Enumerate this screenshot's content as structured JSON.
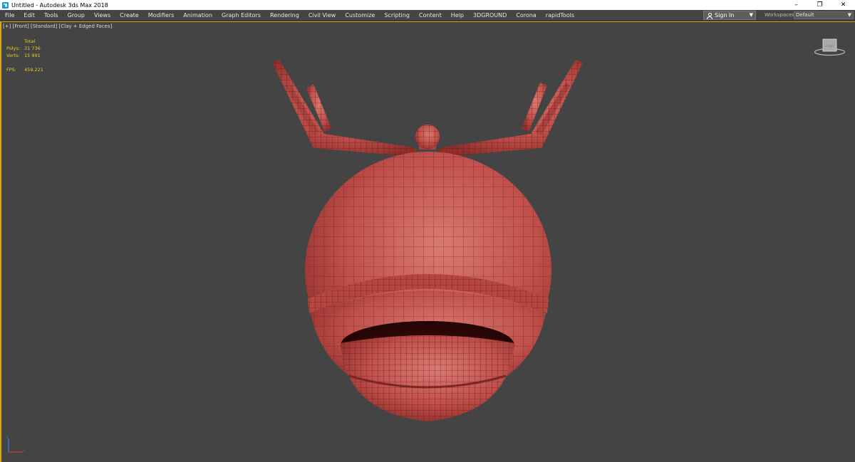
{
  "window": {
    "title": "Untitled - Autodesk 3ds Max 2018",
    "controls": [
      "–",
      "❐",
      "✕"
    ]
  },
  "menu": [
    "File",
    "Edit",
    "Tools",
    "Group",
    "Views",
    "Create",
    "Modifiers",
    "Animation",
    "Graph Editors",
    "Rendering",
    "Civil View",
    "Customize",
    "Scripting",
    "Content",
    "Help",
    "3DGROUND",
    "Corona",
    "rapidTools"
  ],
  "account": {
    "signin_label": "Sign In"
  },
  "workspaces": {
    "label": "Workspaces:",
    "value": "Default"
  },
  "viewport": {
    "labels": [
      "[+]",
      "[Front]",
      "[Standard]",
      "[Clay + Edged Faces]"
    ],
    "stats": {
      "header": "Total",
      "polys_label": "Polys:",
      "polys_value": "31 736",
      "verts_label": "Verts:",
      "verts_value": "15 991",
      "fps_label": "FPS:",
      "fps_value": "459,221"
    },
    "viewcube_face": "FRONT"
  },
  "colors": {
    "viewport_bg": "#444444",
    "active_border": "#d9a81c",
    "stats_text": "#e5d21f",
    "model_clay": "#c0504b",
    "wire": "#5a1412"
  }
}
